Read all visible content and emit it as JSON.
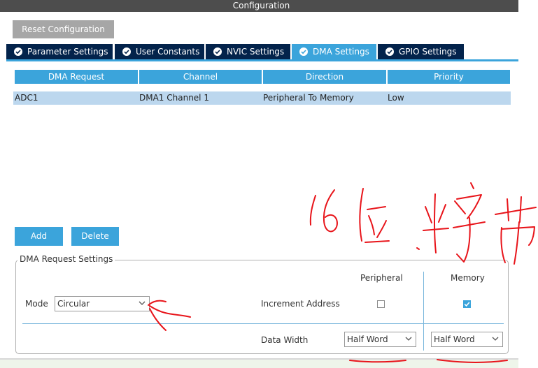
{
  "window": {
    "title": "Configuration"
  },
  "toolbar": {
    "reset_label": "Reset Configuration"
  },
  "tabs": [
    {
      "label": "Parameter Settings",
      "active": false
    },
    {
      "label": "User Constants",
      "active": false
    },
    {
      "label": "NVIC Settings",
      "active": false
    },
    {
      "label": "DMA Settings",
      "active": true
    },
    {
      "label": "GPIO Settings",
      "active": false
    }
  ],
  "table": {
    "headers": [
      "DMA Request",
      "Channel",
      "Direction",
      "Priority"
    ],
    "rows": [
      [
        "ADC1",
        "DMA1 Channel 1",
        "Peripheral To Memory",
        "Low"
      ]
    ]
  },
  "actions": {
    "add_label": "Add",
    "delete_label": "Delete"
  },
  "settings": {
    "legend": "DMA Request Settings",
    "mode_label": "Mode",
    "mode_value": "Circular",
    "peripheral_header": "Peripheral",
    "memory_header": "Memory",
    "increment_label": "Increment Address",
    "increment_peripheral": false,
    "increment_memory": true,
    "data_width_label": "Data Width",
    "peripheral_width": "Half Word",
    "memory_width": "Half Word"
  },
  "annotation": {
    "handwritten_text": "16位半字节"
  },
  "colors": {
    "accent": "#3ba4db",
    "tab_dark": "#03234b",
    "annotation_red": "#e8141a"
  }
}
